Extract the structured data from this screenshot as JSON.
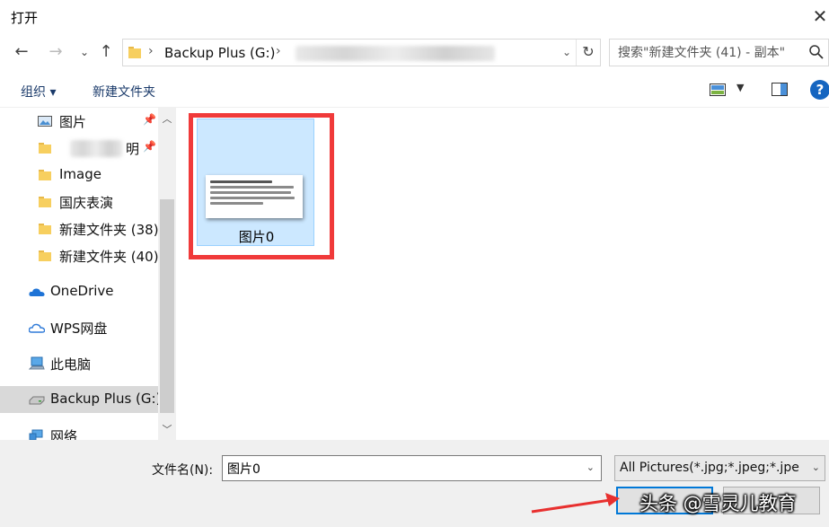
{
  "window": {
    "title": "打开"
  },
  "address": {
    "drive_segment": "Backup Plus (G:)"
  },
  "search": {
    "placeholder": "搜索\"新建文件夹 (41) - 副本\""
  },
  "toolbar": {
    "organize_label": "组织 ▾",
    "new_folder_label": "新建文件夹"
  },
  "nav": {
    "items": [
      {
        "label": "图片"
      },
      {
        "label": "明"
      },
      {
        "label": "Image"
      },
      {
        "label": "国庆表演"
      },
      {
        "label": "新建文件夹 (38)"
      },
      {
        "label": "新建文件夹 (40)"
      },
      {
        "label": "OneDrive"
      },
      {
        "label": "WPS网盘"
      },
      {
        "label": "此电脑"
      },
      {
        "label": "Backup Plus (G:)"
      },
      {
        "label": "网络"
      }
    ]
  },
  "files": [
    {
      "name": "图片0",
      "selected": true
    }
  ],
  "bottom": {
    "filename_label": "文件名(N):",
    "filename_value": "图片0",
    "filetype_value": "All Pictures(*.jpg;*.jpeg;*.jpe"
  },
  "watermark": "头条 @雪灵儿教育",
  "colors": {
    "accent": "#0078d7",
    "selection_bg": "#cce8ff",
    "annotation_red": "#f03a3a",
    "help_blue": "#1565c0"
  }
}
